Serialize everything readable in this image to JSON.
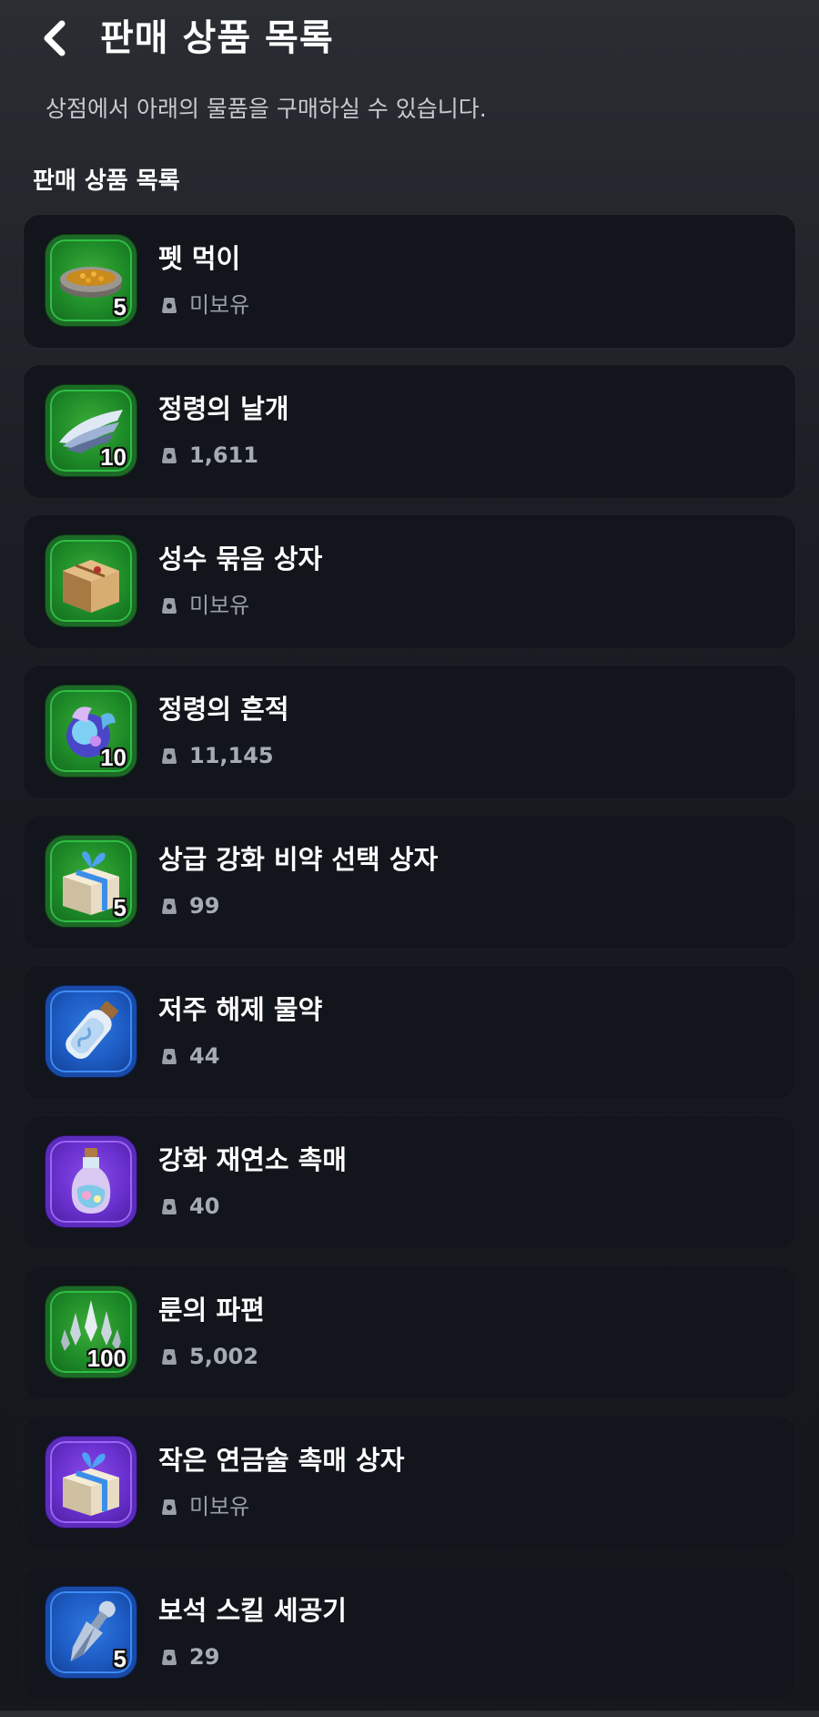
{
  "header": {
    "back_icon": "chevron-left-icon",
    "title": "판매 상품 목록"
  },
  "subtitle": "상점에서 아래의 물품을 구매하실 수 있습니다.",
  "section_title": "판매 상품 목록",
  "owned_icon": "bag-icon",
  "items": [
    {
      "name": "펫 먹이",
      "quantity": "5",
      "owned": "미보유",
      "frame": "green",
      "icon": "pet-food-bowl-icon"
    },
    {
      "name": "정령의 날개",
      "quantity": "10",
      "owned": "1,611",
      "frame": "green",
      "icon": "wing-icon"
    },
    {
      "name": "성수 묶음 상자",
      "quantity": "",
      "owned": "미보유",
      "frame": "green",
      "icon": "parcel-box-icon"
    },
    {
      "name": "정령의 흔적",
      "quantity": "10",
      "owned": "11,145",
      "frame": "green",
      "icon": "spirit-trace-icon"
    },
    {
      "name": "상급 강화 비약 선택 상자",
      "quantity": "5",
      "owned": "99",
      "frame": "green",
      "icon": "gift-box-icon"
    },
    {
      "name": "저주 해제 물약",
      "quantity": "",
      "owned": "44",
      "frame": "blue",
      "icon": "potion-bottle-icon"
    },
    {
      "name": "강화 재연소 촉매",
      "quantity": "",
      "owned": "40",
      "frame": "purple",
      "icon": "catalyst-bottle-icon"
    },
    {
      "name": "룬의 파편",
      "quantity": "100",
      "owned": "5,002",
      "frame": "green",
      "icon": "rune-shard-icon"
    },
    {
      "name": "작은 연금술 촉매 상자",
      "quantity": "",
      "owned": "미보유",
      "frame": "purple",
      "icon": "gift-box-icon"
    },
    {
      "name": "보석 스킬 세공기",
      "quantity": "5",
      "owned": "29",
      "frame": "blue",
      "icon": "gem-tool-icon"
    }
  ]
}
